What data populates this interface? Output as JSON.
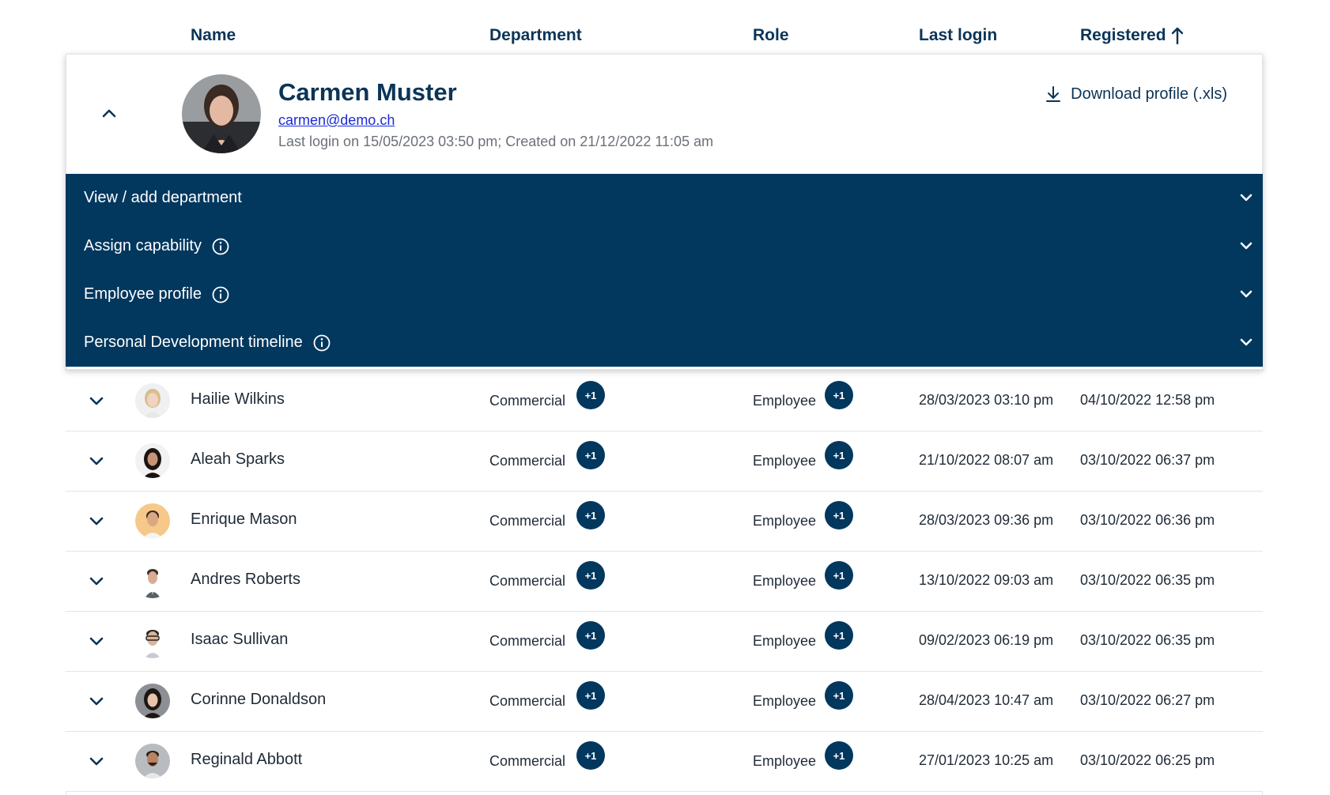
{
  "header": {
    "name": "Name",
    "department": "Department",
    "role": "Role",
    "last_login": "Last login",
    "registered": "Registered",
    "sort_icon": "arrow-up-icon"
  },
  "expanded_user": {
    "name": "Carmen Muster",
    "email": "carmen@demo.ch",
    "meta": "Last login on 15/05/2023 03:50 pm; Created on 21/12/2022 11:05 am",
    "download_label": "Download profile (.xls)",
    "accordion": [
      {
        "label": "View / add department",
        "has_info": false
      },
      {
        "label": "Assign capability",
        "has_info": true
      },
      {
        "label": "Employee profile",
        "has_info": true
      },
      {
        "label": "Personal Development timeline",
        "has_info": true
      }
    ]
  },
  "rows": [
    {
      "name": "Hailie Wilkins",
      "department": "Commercial",
      "dept_badge": "+1",
      "role": "Employee",
      "role_badge": "+1",
      "last_login": "28/03/2023 03:10 pm",
      "registered": "04/10/2022 12:58 pm"
    },
    {
      "name": "Aleah Sparks",
      "department": "Commercial",
      "dept_badge": "+1",
      "role": "Employee",
      "role_badge": "+1",
      "last_login": "21/10/2022 08:07 am",
      "registered": "03/10/2022 06:37 pm"
    },
    {
      "name": "Enrique Mason",
      "department": "Commercial",
      "dept_badge": "+1",
      "role": "Employee",
      "role_badge": "+1",
      "last_login": "28/03/2023 09:36 pm",
      "registered": "03/10/2022 06:36 pm"
    },
    {
      "name": "Andres Roberts",
      "department": "Commercial",
      "dept_badge": "+1",
      "role": "Employee",
      "role_badge": "+1",
      "last_login": "13/10/2022 09:03 am",
      "registered": "03/10/2022 06:35 pm"
    },
    {
      "name": "Isaac Sullivan",
      "department": "Commercial",
      "dept_badge": "+1",
      "role": "Employee",
      "role_badge": "+1",
      "last_login": "09/02/2023 06:19 pm",
      "registered": "03/10/2022 06:35 pm"
    },
    {
      "name": "Corinne Donaldson",
      "department": "Commercial",
      "dept_badge": "+1",
      "role": "Employee",
      "role_badge": "+1",
      "last_login": "28/04/2023 10:47 am",
      "registered": "03/10/2022 06:27 pm"
    },
    {
      "name": "Reginald Abbott",
      "department": "Commercial",
      "dept_badge": "+1",
      "role": "Employee",
      "role_badge": "+1",
      "last_login": "27/01/2023 10:25 am",
      "registered": "03/10/2022 06:25 pm"
    }
  ],
  "colors": {
    "primary": "#02375e",
    "header_text": "#0b3457",
    "link": "#1a2bd6"
  }
}
